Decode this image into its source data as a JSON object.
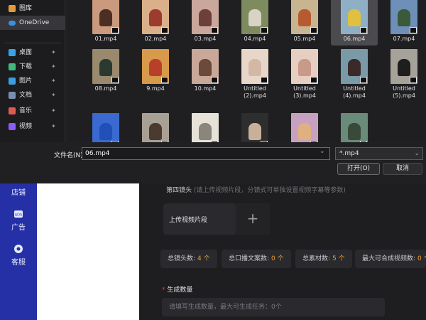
{
  "dialog": {
    "nav_items": [
      {
        "label": "图库",
        "icon": "gallery-icon",
        "color": "#e39a3c",
        "pinned": false
      },
      {
        "label": "OneDrive",
        "icon": "onedrive-icon",
        "color": "#3b8fe0",
        "pinned": false,
        "selected": true
      },
      {
        "label": "桌面",
        "icon": "desktop-icon",
        "color": "#3aa3e8",
        "pinned": true
      },
      {
        "label": "下载",
        "icon": "download-icon",
        "color": "#3fb87e",
        "pinned": true
      },
      {
        "label": "图片",
        "icon": "pictures-icon",
        "color": "#3a9ee0",
        "pinned": true
      },
      {
        "label": "文档",
        "icon": "documents-icon",
        "color": "#7a8fb0",
        "pinned": true
      },
      {
        "label": "音乐",
        "icon": "music-icon",
        "color": "#e05b4f",
        "pinned": true
      },
      {
        "label": "视频",
        "icon": "videos-icon",
        "color": "#8b5cf6",
        "pinned": true
      }
    ],
    "files": [
      {
        "name": "01.mp4",
        "bg": "#c99a7d",
        "fg": "#4b2f23"
      },
      {
        "name": "02.mp4",
        "bg": "#d9b08a",
        "fg": "#9c3b2e"
      },
      {
        "name": "03.mp4",
        "bg": "#c9a79b",
        "fg": "#6d3f3a"
      },
      {
        "name": "04.mp4",
        "bg": "#7e8b5f",
        "fg": "#d8d3c4"
      },
      {
        "name": "05.mp4",
        "bg": "#c8b58f",
        "fg": "#b85a2f"
      },
      {
        "name": "06.mp4",
        "bg": "#8fb0c4",
        "fg": "#e0c040",
        "selected": true
      },
      {
        "name": "07.mp4",
        "bg": "#6d8fb8",
        "fg": "#3a5a3a"
      },
      {
        "name": "08.mp4",
        "bg": "#9a8a6d",
        "fg": "#2a3a30"
      },
      {
        "name": "9.mp4",
        "bg": "#d69a4a",
        "fg": "#b8402a"
      },
      {
        "name": "10.mp4",
        "bg": "#c9a89a",
        "fg": "#6b4a3a"
      },
      {
        "name": "Untitled (2).mp4",
        "bg": "#e8d6c8",
        "fg": "#d4b8a6"
      },
      {
        "name": "Untitled (3).mp4",
        "bg": "#e6cec0",
        "fg": "#c89a8a"
      },
      {
        "name": "Untitled (4).mp4",
        "bg": "#7a9aa8",
        "fg": "#3a2a2a"
      },
      {
        "name": "Untitled (5).mp4",
        "bg": "#a6a29a",
        "fg": "#1e1e1e"
      },
      {
        "name": "",
        "bg": "#3a6ad0",
        "fg": "#2050b8"
      },
      {
        "name": "",
        "bg": "#a8a094",
        "fg": "#4a3a30"
      },
      {
        "name": "",
        "bg": "#e6e2d8",
        "fg": "#8a867e"
      },
      {
        "name": "",
        "bg": "#2e2e2e",
        "fg": "#c9b09a"
      },
      {
        "name": "",
        "bg": "#c8a0c0",
        "fg": "#e0b080"
      },
      {
        "name": "",
        "bg": "#6a8a7a",
        "fg": "#3a4a3a"
      }
    ],
    "filename_label": "文件名(N):",
    "filename_value": "06.mp4",
    "filter_value": "*.mp4",
    "open_label": "打开(O)",
    "cancel_label": "取消"
  },
  "app": {
    "sidebar": [
      {
        "label": "店铺",
        "icon": "store-icon"
      },
      {
        "label": "广告",
        "icon": "ads-icon"
      },
      {
        "label": "客服",
        "icon": "support-icon"
      }
    ],
    "section_title": "第四镜头",
    "section_hint": "(请上传视频片段，分镜式可单独设置视频字幕等参数)",
    "upload_label": "上传视频片段",
    "stats": [
      {
        "label": "总镜头数:",
        "value": "4 个"
      },
      {
        "label": "总口播文案数:",
        "value": "0 个"
      },
      {
        "label": "总素材数:",
        "value": "5 个"
      },
      {
        "label": "最大可合成视频数:",
        "value": "0 个"
      }
    ],
    "generate_label": "生成数量",
    "required_mark": "*",
    "generate_placeholder": "请填写生成数量，最大可生成任务：0个"
  }
}
